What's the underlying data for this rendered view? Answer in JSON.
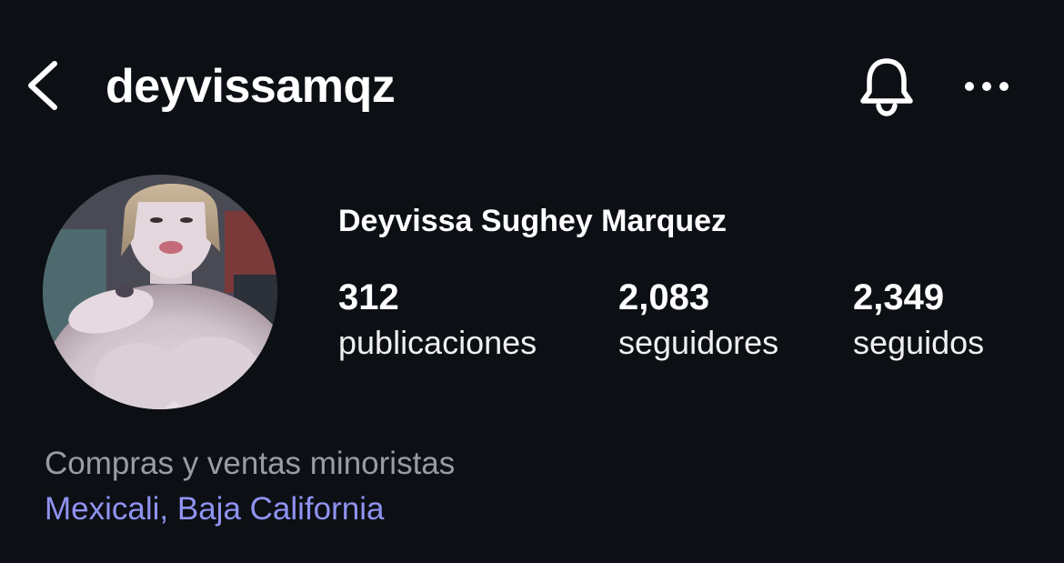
{
  "header": {
    "username": "deyvissamqz"
  },
  "profile": {
    "display_name": "Deyvissa Sughey Marquez",
    "stats": {
      "posts_count": "312",
      "posts_label": "publicaciones",
      "followers_count": "2,083",
      "followers_label": "seguidores",
      "following_count": "2,349",
      "following_label": "seguidos"
    }
  },
  "bio": {
    "category": "Compras y ventas minoristas",
    "location": "Mexicali, Baja California"
  },
  "icons": {
    "back": "chevron-left-icon",
    "notifications": "bell-icon",
    "more": "more-horizontal-icon"
  },
  "colors": {
    "background": "#0c0f14",
    "text_primary": "#ffffff",
    "text_secondary": "#9a9ca3",
    "link": "#8f93f0"
  }
}
